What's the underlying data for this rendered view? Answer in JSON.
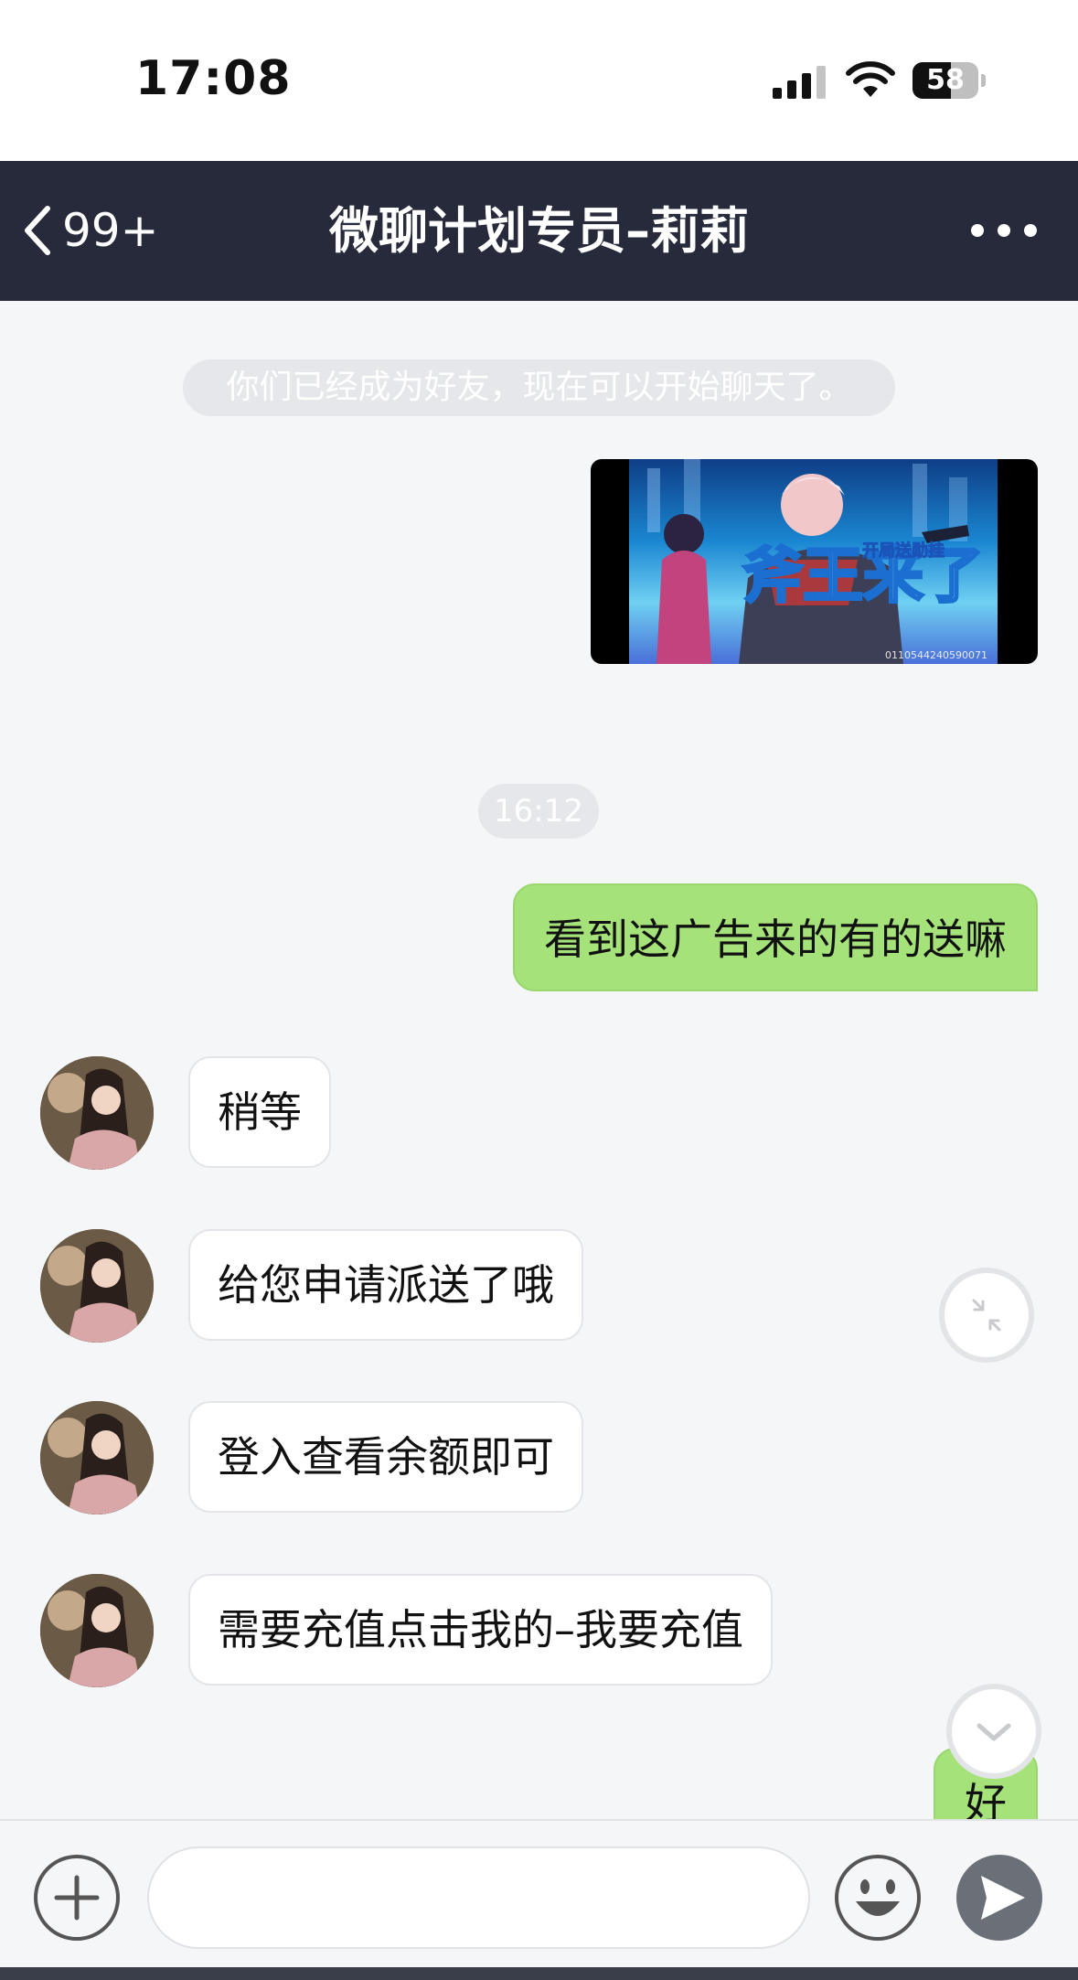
{
  "status_bar": {
    "time": "17:08",
    "battery": "58",
    "battery_level_percent": 58
  },
  "header": {
    "back_count": "99+",
    "title": "微聊计划专员–莉莉"
  },
  "chat": {
    "system_notice": "你们已经成为好友，现在可以开始聊天了。",
    "timestamp": "16:12",
    "image_message": {
      "overlay_text": "斧王来了",
      "badge_text": "开局送勋挂",
      "code_text": "0110544240590071"
    },
    "messages": [
      {
        "side": "out",
        "text": "看到这广告来的有的送嘛"
      },
      {
        "side": "in",
        "text": "稍等"
      },
      {
        "side": "in",
        "text": "给您申请派送了哦"
      },
      {
        "side": "in",
        "text": "登入查看余额即可"
      },
      {
        "side": "in",
        "text": "需要充值点击我的–我要充值"
      },
      {
        "side": "out",
        "text": "好"
      }
    ]
  },
  "input": {
    "placeholder": "",
    "value": ""
  },
  "icons": {
    "back": "chevron-left-icon",
    "more": "more-dots-icon",
    "add": "plus-circle-icon",
    "emoji": "emoji-icon",
    "send": "send-icon",
    "collapse": "collapse-arrows-icon",
    "scroll_down": "chevron-down-icon"
  },
  "colors": {
    "nav_bg": "#262a3b",
    "outgoing_bubble": "#a5e37a",
    "incoming_bubble": "#ffffff",
    "chat_bg": "#f5f6f8"
  }
}
